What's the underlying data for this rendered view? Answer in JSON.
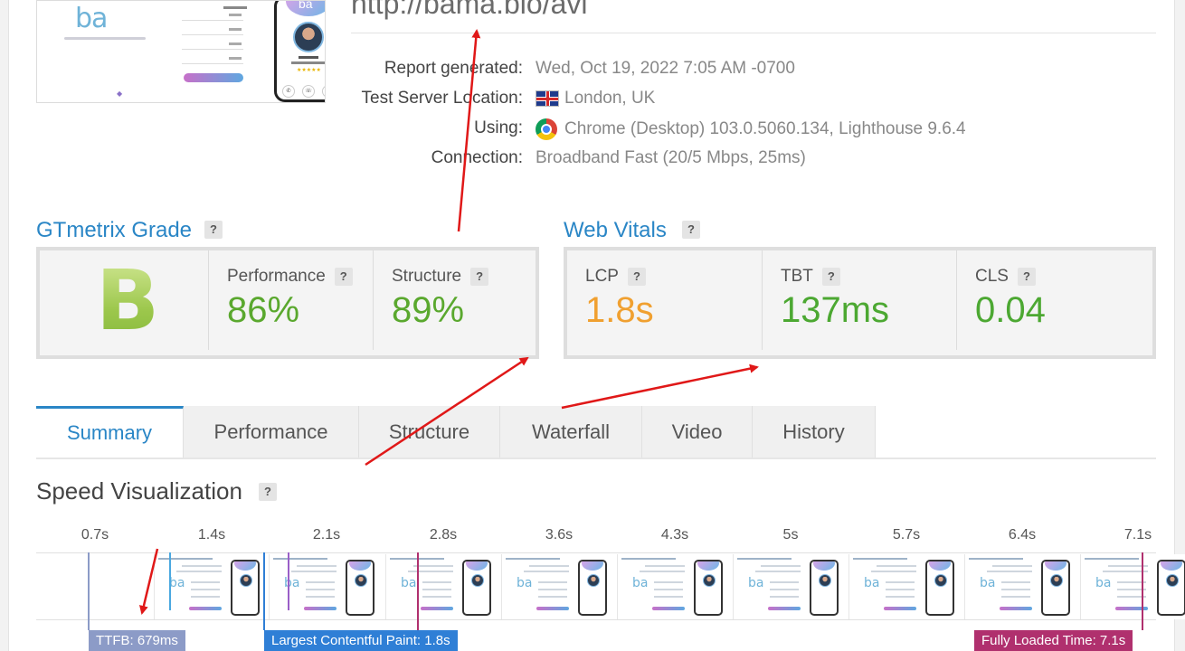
{
  "report": {
    "url": "http://bama.bio/avi",
    "details": [
      {
        "label": "Report generated:",
        "value": "Wed, Oct 19, 2022 7:05 AM -0700",
        "icon": ""
      },
      {
        "label": "Test Server Location:",
        "value": "London, UK",
        "icon": "uk-flag-icon"
      },
      {
        "label": "Using:",
        "value": "Chrome (Desktop) 103.0.5060.134, Lighthouse 9.6.4",
        "icon": "chrome-icon"
      },
      {
        "label": "Connection:",
        "value": "Broadband Fast (20/5 Mbps, 25ms)",
        "icon": ""
      }
    ]
  },
  "grade": {
    "title": "GTmetrix Grade",
    "help": "?",
    "letter": "B",
    "performance_label": "Performance",
    "performance_value": "86%",
    "structure_label": "Structure",
    "structure_value": "89%"
  },
  "vitals": {
    "title": "Web Vitals",
    "help": "?",
    "lcp_label": "LCP",
    "lcp_value": "1.8s",
    "tbt_label": "TBT",
    "tbt_value": "137ms",
    "cls_label": "CLS",
    "cls_value": "0.04"
  },
  "colors": {
    "accent": "#2a86c6",
    "good_green": "#5aa82e",
    "lcp_orange": "#f0a030",
    "ttfb": "#8c9bc7",
    "lcp_marker": "#2f7fd6",
    "fully_loaded": "#b0306e"
  },
  "tabs": [
    "Summary",
    "Performance",
    "Structure",
    "Waterfall",
    "Video",
    "History"
  ],
  "speed": {
    "title": "Speed Visualization",
    "help": "?",
    "times": [
      "0.7s",
      "1.4s",
      "2.1s",
      "2.8s",
      "3.6s",
      "4.3s",
      "5s",
      "5.7s",
      "6.4s",
      "7.1s"
    ],
    "ttfb_label": "TTFB: 679ms",
    "lcp_label": "Largest Contentful Paint: 1.8s",
    "fully_loaded_label": "Fully Loaded Time: 7.1s"
  },
  "thumbnail": {
    "logo": "ba"
  }
}
